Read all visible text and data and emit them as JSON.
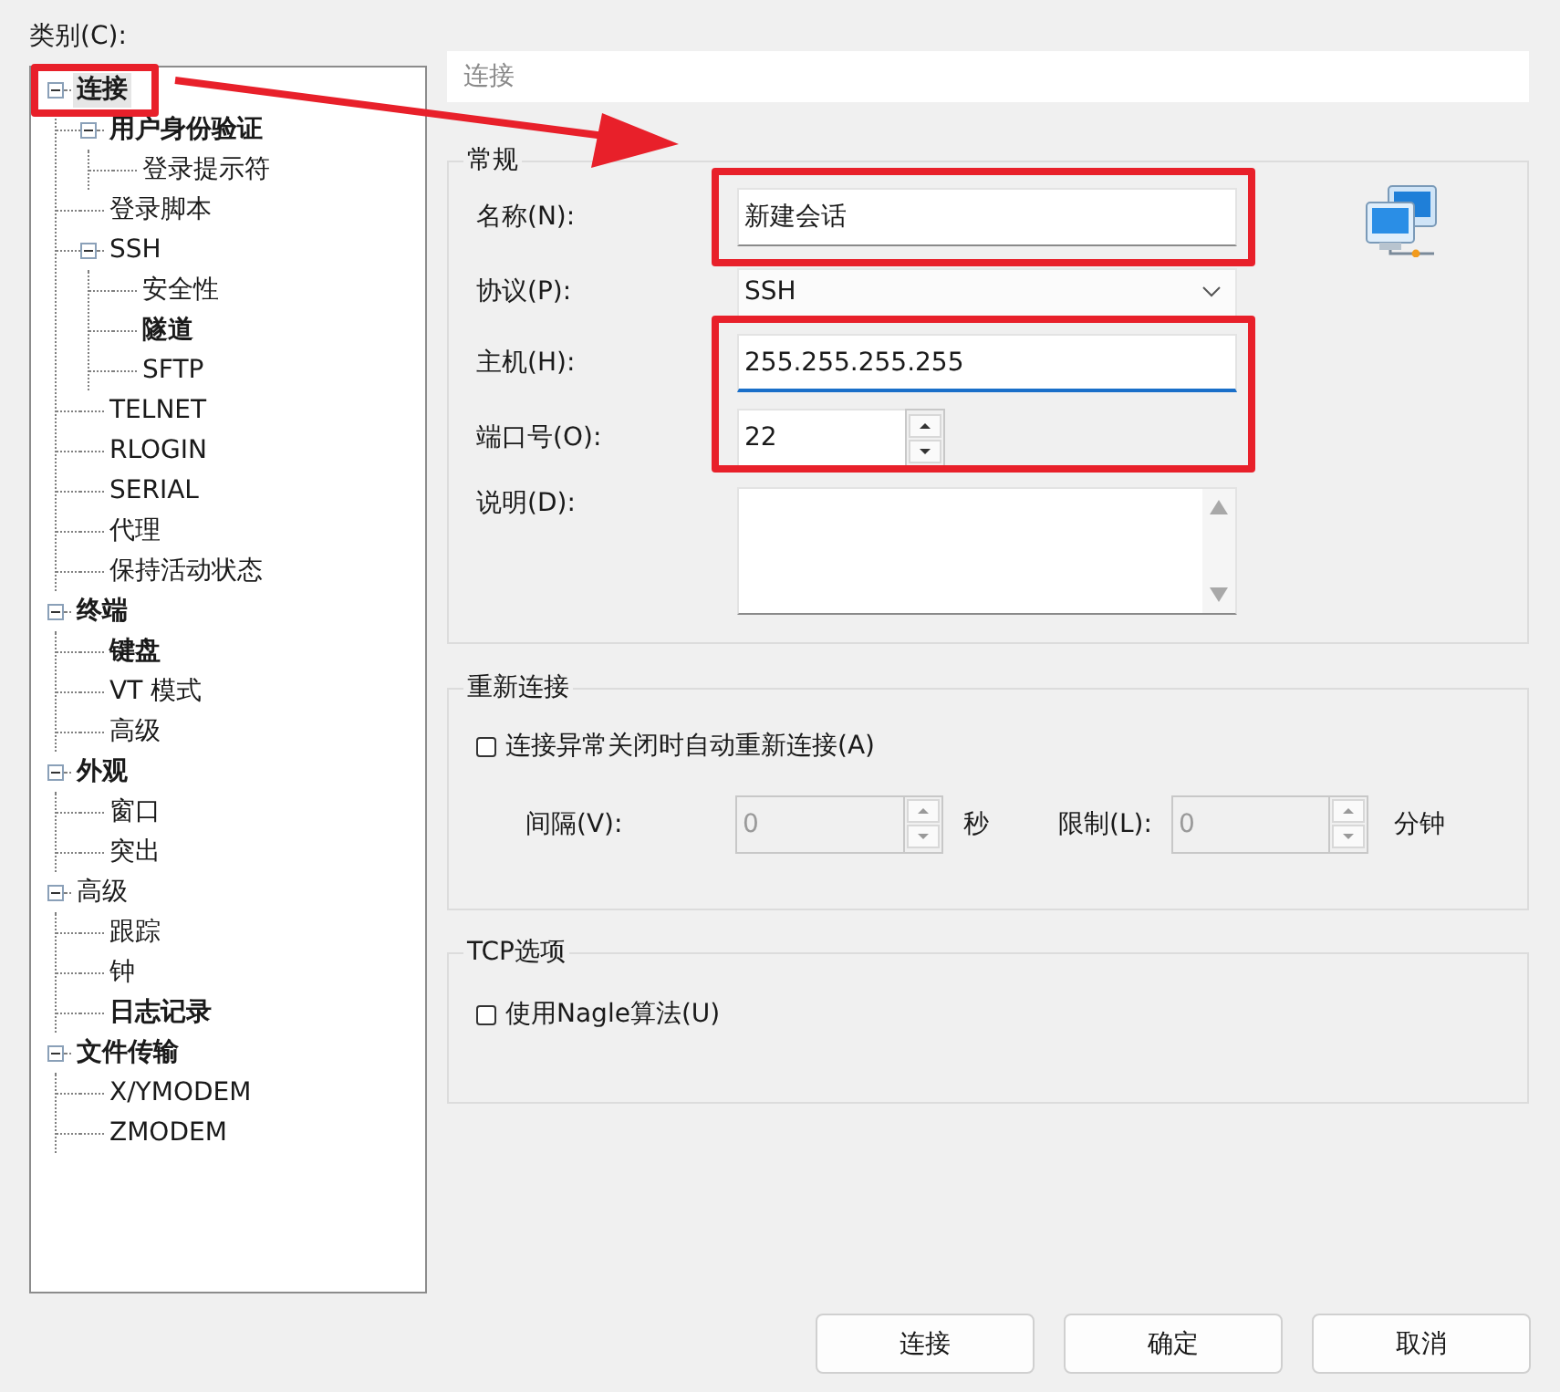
{
  "category_label": "类别(C):",
  "tree": [
    {
      "label": "连接",
      "bold": true,
      "selected": true,
      "expanded": true,
      "children": [
        {
          "label": "用户身份验证",
          "bold": true,
          "selected": false,
          "expanded": true,
          "children": [
            {
              "label": "登录提示符",
              "bold": false,
              "selected": false
            }
          ]
        },
        {
          "label": "登录脚本",
          "bold": false,
          "selected": false
        },
        {
          "label": "SSH",
          "bold": false,
          "selected": false,
          "expanded": true,
          "children": [
            {
              "label": "安全性",
              "bold": false,
              "selected": false
            },
            {
              "label": "隧道",
              "bold": true,
              "selected": false
            },
            {
              "label": "SFTP",
              "bold": false,
              "selected": false
            }
          ]
        },
        {
          "label": "TELNET",
          "bold": false,
          "selected": false
        },
        {
          "label": "RLOGIN",
          "bold": false,
          "selected": false
        },
        {
          "label": "SERIAL",
          "bold": false,
          "selected": false
        },
        {
          "label": "代理",
          "bold": false,
          "selected": false
        },
        {
          "label": "保持活动状态",
          "bold": false,
          "selected": false
        }
      ]
    },
    {
      "label": "终端",
      "bold": true,
      "selected": false,
      "expanded": true,
      "children": [
        {
          "label": "键盘",
          "bold": true,
          "selected": false
        },
        {
          "label": "VT 模式",
          "bold": false,
          "selected": false
        },
        {
          "label": "高级",
          "bold": false,
          "selected": false
        }
      ]
    },
    {
      "label": "外观",
      "bold": true,
      "selected": false,
      "expanded": true,
      "children": [
        {
          "label": "窗口",
          "bold": false,
          "selected": false
        },
        {
          "label": "突出",
          "bold": false,
          "selected": false
        }
      ]
    },
    {
      "label": "高级",
      "bold": false,
      "selected": false,
      "expanded": true,
      "children": [
        {
          "label": "跟踪",
          "bold": false,
          "selected": false
        },
        {
          "label": "钟",
          "bold": false,
          "selected": false
        },
        {
          "label": "日志记录",
          "bold": true,
          "selected": false
        }
      ]
    },
    {
      "label": "文件传输",
      "bold": true,
      "selected": false,
      "expanded": true,
      "children": [
        {
          "label": "X/YMODEM",
          "bold": false,
          "selected": false
        },
        {
          "label": "ZMODEM",
          "bold": false,
          "selected": false
        }
      ]
    }
  ],
  "page_title": "连接",
  "general": {
    "title": "常规",
    "name": {
      "label": "名称(N):",
      "value": "新建会话"
    },
    "protocol": {
      "label": "协议(P):",
      "value": "SSH"
    },
    "host": {
      "label": "主机(H):",
      "value": "255.255.255.255"
    },
    "port": {
      "label": "端口号(O):",
      "value": "22"
    },
    "description": {
      "label": "说明(D):"
    }
  },
  "reconnect": {
    "title": "重新连接",
    "checkbox": {
      "label": "连接异常关闭时自动重新连接(A)",
      "checked": false
    },
    "interval": {
      "label": "间隔(V):",
      "value": "0",
      "unit": "秒",
      "disabled": true
    },
    "limit": {
      "label": "限制(L):",
      "value": "0",
      "unit": "分钟",
      "disabled": true
    }
  },
  "tcp": {
    "title": "TCP选项",
    "checkbox": {
      "label": "使用Nagle算法(U)",
      "checked": false
    }
  },
  "buttons": [
    "连接",
    "确定",
    "取消"
  ],
  "annotations": [
    {
      "kind": "box"
    },
    {
      "kind": "box"
    },
    {
      "kind": "box"
    },
    {
      "kind": "arrow"
    }
  ]
}
